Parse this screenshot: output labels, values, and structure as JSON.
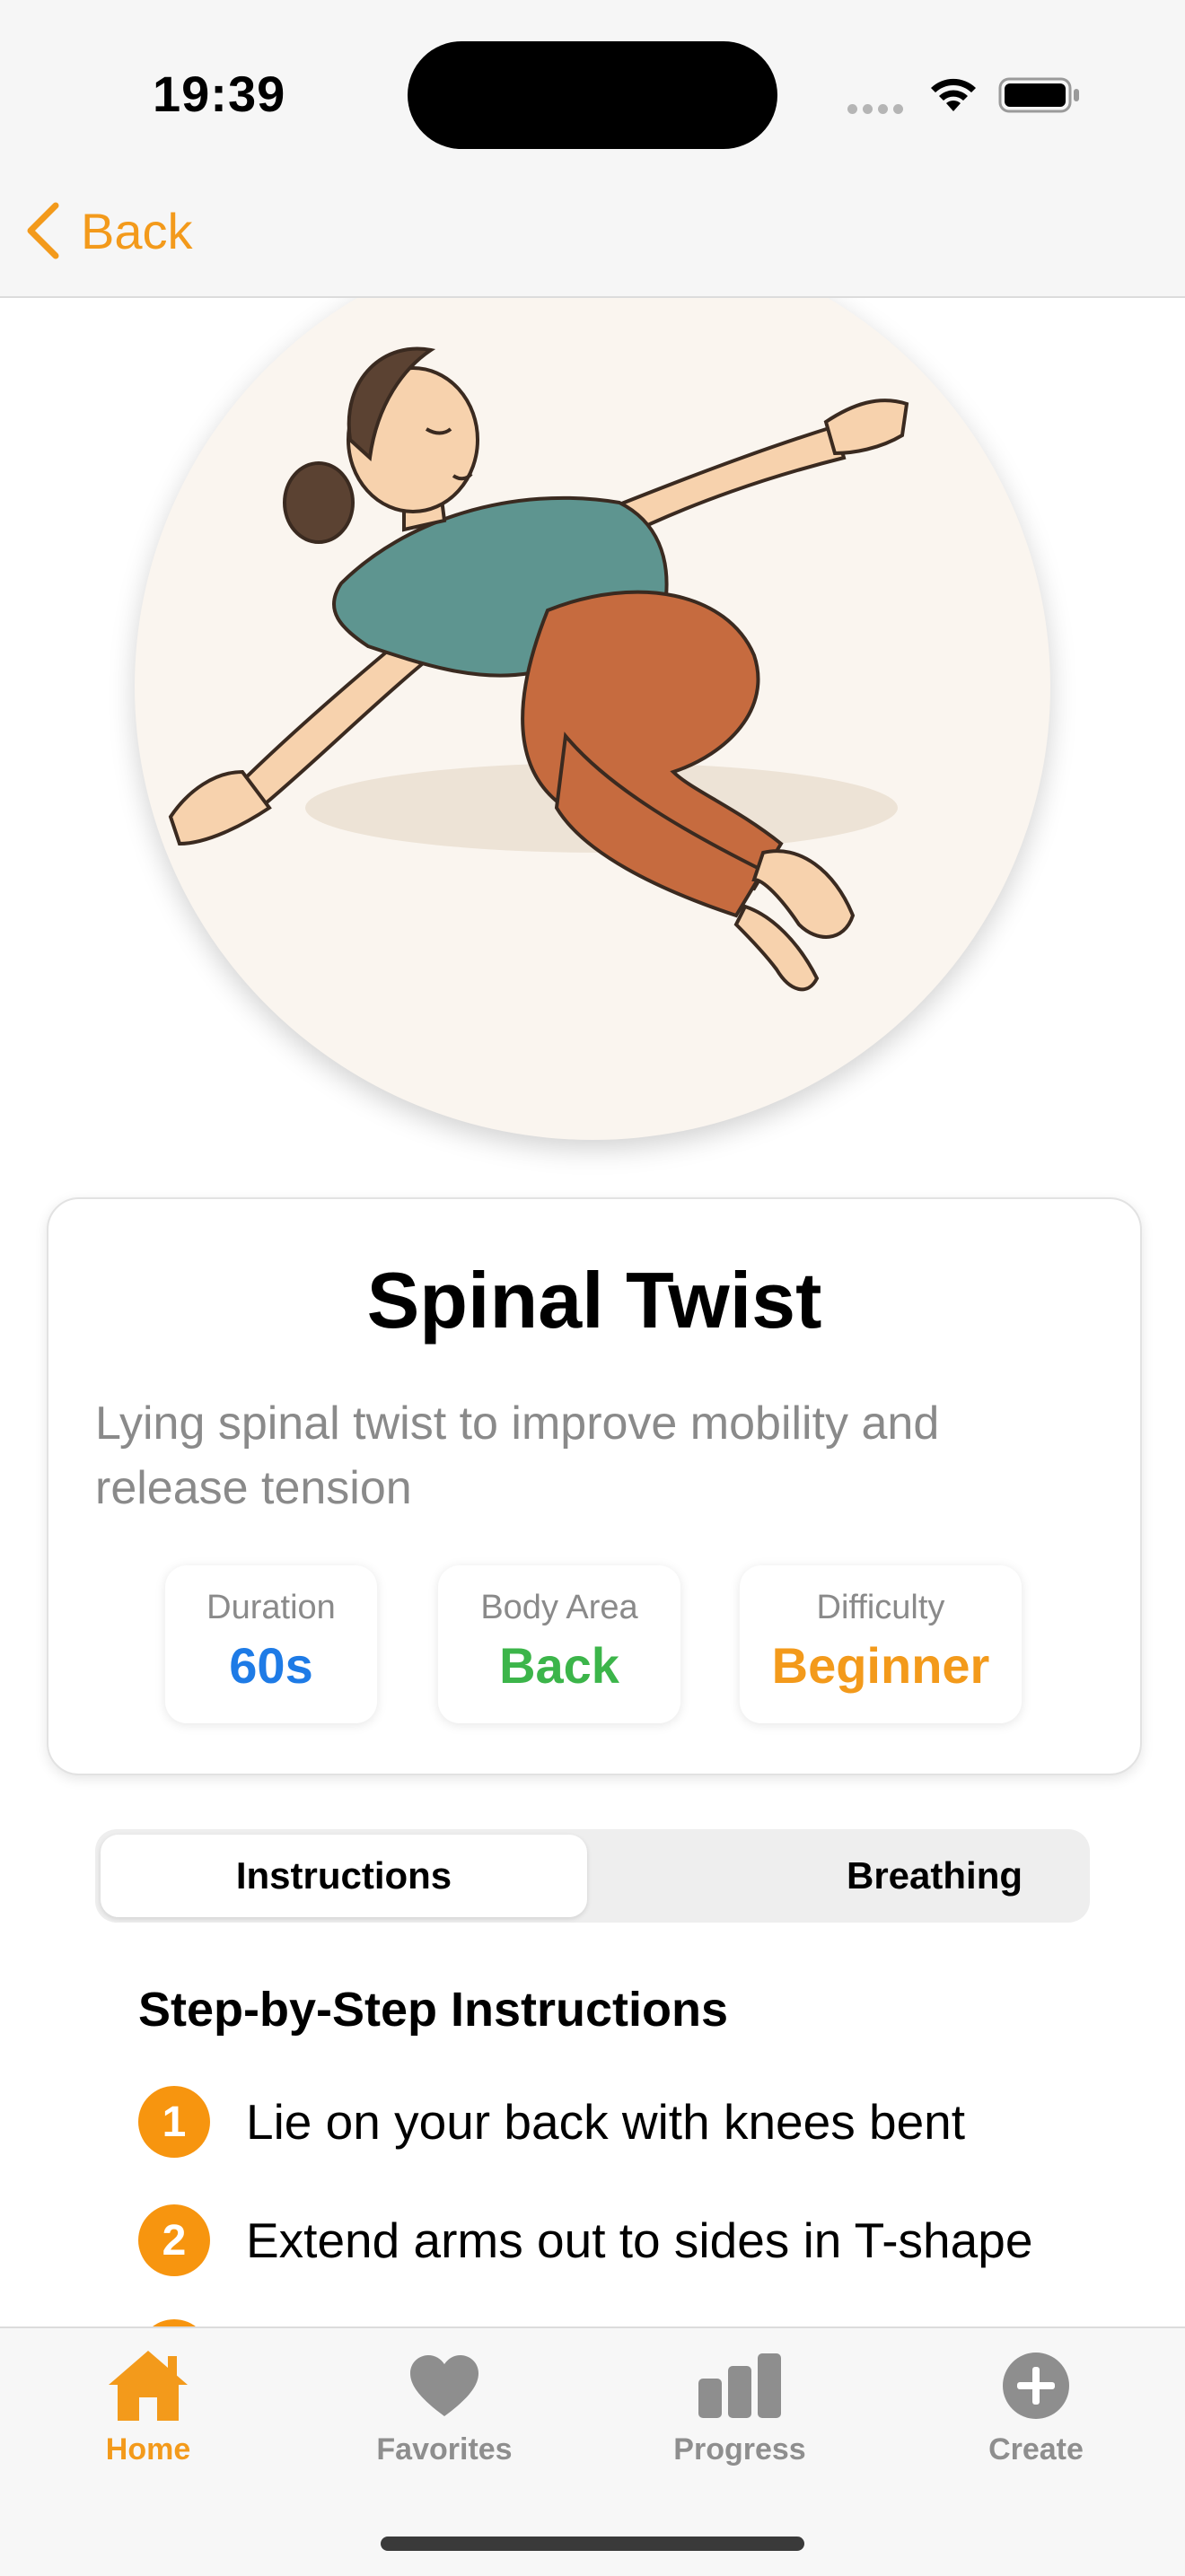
{
  "status_bar": {
    "time": "19:39"
  },
  "nav": {
    "back_label": "Back"
  },
  "exercise": {
    "title": "Spinal Twist",
    "description": "Lying spinal twist to improve mobility and release tension",
    "stats": [
      {
        "label": "Duration",
        "value": "60s",
        "color": "#1e7be6"
      },
      {
        "label": "Body Area",
        "value": "Back",
        "color": "#3cb54a"
      },
      {
        "label": "Difficulty",
        "value": "Beginner",
        "color": "#f39a1b"
      }
    ]
  },
  "tabs_segment": {
    "active": "Instructions",
    "inactive": "Breathing"
  },
  "instructions": {
    "heading": "Step-by-Step Instructions",
    "steps": [
      {
        "number": "1",
        "text": "Lie on your back with knees bent"
      },
      {
        "number": "2",
        "text": "Extend arms out to sides in T-shape"
      }
    ]
  },
  "tab_bar": {
    "items": [
      {
        "label": "Home",
        "icon": "house-icon",
        "active": true
      },
      {
        "label": "Favorites",
        "icon": "heart-icon",
        "active": false
      },
      {
        "label": "Progress",
        "icon": "bar-chart-icon",
        "active": false
      },
      {
        "label": "Create",
        "icon": "plus-circle-icon",
        "active": false
      }
    ]
  },
  "colors": {
    "accent": "#f39a1b",
    "step_badge": "#f7950f"
  }
}
